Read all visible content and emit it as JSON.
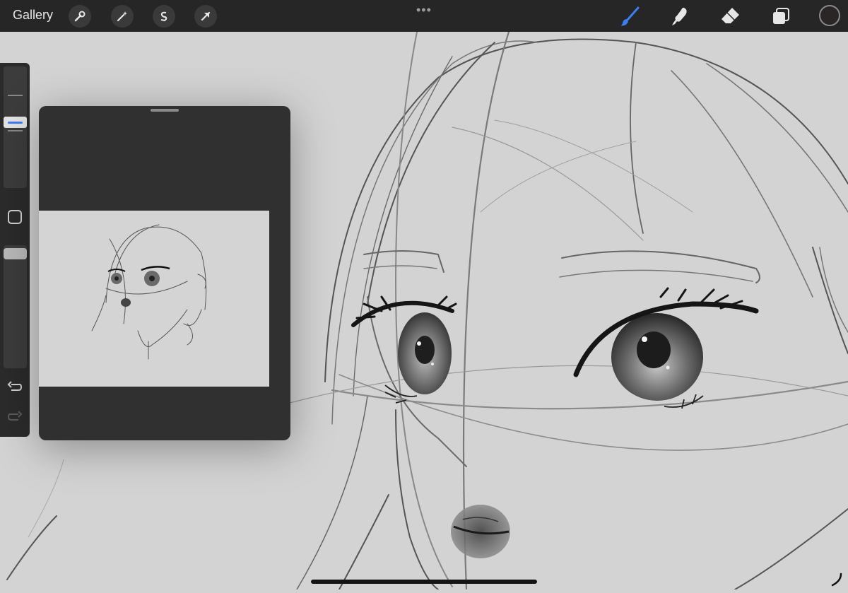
{
  "topbar": {
    "gallery_label": "Gallery",
    "left_tools": [
      "wrench-icon",
      "magic-wand-icon",
      "selection-s-icon",
      "transform-arrow-icon"
    ],
    "more_dots": "•••",
    "right_tools": [
      "brush-icon",
      "smudge-icon",
      "eraser-icon",
      "layers-icon"
    ],
    "active_tool": "brush-icon",
    "accent_color": "#3d7ef5",
    "current_color": "#2a2626"
  },
  "sidebar": {
    "brush_size_level": 0.45,
    "opacity_level": 0.9,
    "undo_icon": "undo-icon",
    "redo_icon": "redo-icon"
  },
  "reference_panel": {
    "handle_icon": "drag-handle-icon"
  },
  "canvas": {
    "background": "#d3d3d3"
  }
}
